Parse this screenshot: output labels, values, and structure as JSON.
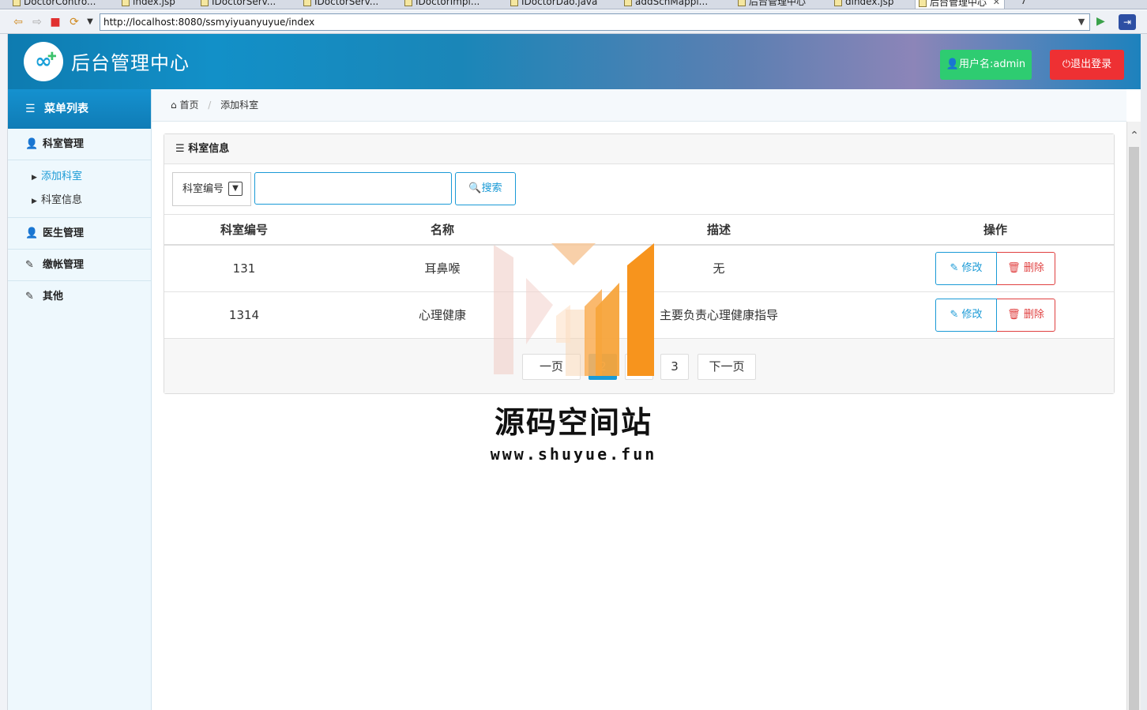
{
  "ide": {
    "tabs": [
      "DoctorContro...",
      "index.jsp",
      "IDoctorServ...",
      "IDoctorServ...",
      "IDoctorImpl...",
      "IDoctorDao.java",
      "addSchMappi...",
      "后台管理中心",
      "dindex.jsp",
      "后台管理中心"
    ],
    "overflow": "7"
  },
  "browser": {
    "url": "http://localhost:8080/ssmyiyuanyuyue/index"
  },
  "header": {
    "title": "后台管理中心",
    "user_label": "用户名:admin",
    "logout_label": "退出登录"
  },
  "sidebar": {
    "title": "菜单列表",
    "groups": [
      {
        "label": "科室管理",
        "icon": "user-icon",
        "items": [
          "添加科室",
          "科室信息"
        ]
      },
      {
        "label": "医生管理",
        "icon": "user-icon"
      },
      {
        "label": "缴帐管理",
        "icon": "edit-icon"
      },
      {
        "label": "其他",
        "icon": "edit-icon"
      }
    ]
  },
  "breadcrumb": {
    "home": "首页",
    "current": "添加科室"
  },
  "panel": {
    "title": "科室信息",
    "search": {
      "field": "科室编号",
      "button": "搜索"
    },
    "columns": [
      "科室编号",
      "名称",
      "描述",
      "操作"
    ],
    "rows": [
      {
        "id": "131",
        "name": "耳鼻喉",
        "desc": "无"
      },
      {
        "id": "1314",
        "name": "心理健康",
        "desc": "主要负责心理健康指导"
      }
    ],
    "actions": {
      "edit": "修改",
      "delete": "删除"
    },
    "pager": {
      "prev": "一页",
      "current": "2",
      "two": "",
      "three": "3",
      "next": "下一页"
    }
  },
  "watermark": {
    "text": "源码空间站",
    "url": "www.shuyue.fun"
  },
  "colors": {
    "primary": "#1a9ad6",
    "success": "#2ecc71",
    "danger": "#ee3033",
    "watermark_orange": "#f7941d"
  }
}
